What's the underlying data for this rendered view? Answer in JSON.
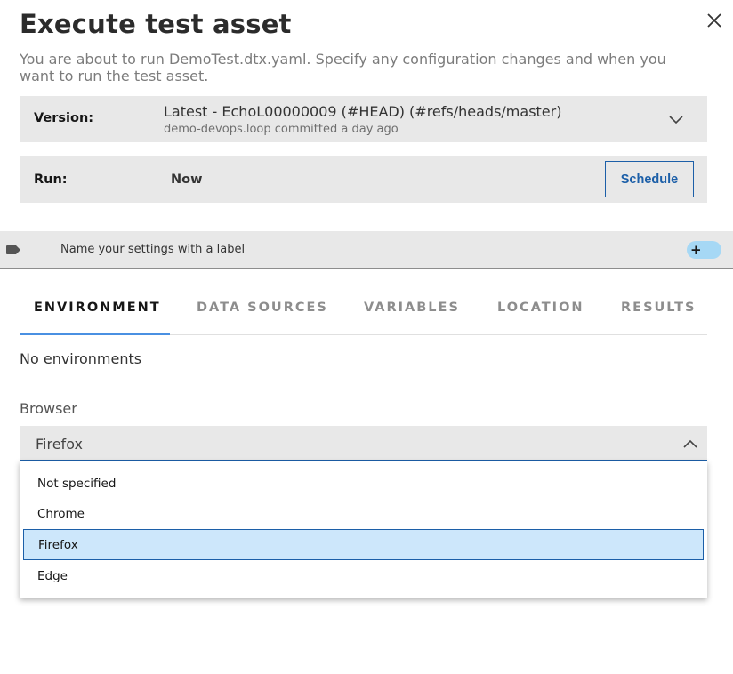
{
  "dialog": {
    "title": "Execute test asset",
    "description": "You are about to run DemoTest.dtx.yaml. Specify any configuration changes and when you want to run the test asset."
  },
  "version": {
    "label": "Version:",
    "value": "Latest - EchoL00000009 (#HEAD) (#refs/heads/master)",
    "commit_info": "demo-devops.loop committed a day ago"
  },
  "run": {
    "label": "Run:",
    "value": "Now",
    "schedule_label": "Schedule"
  },
  "label_bar": {
    "text": "Name your settings with a label",
    "toggle_symbol": "+"
  },
  "tabs": [
    {
      "label": "ENVIRONMENT",
      "active": true
    },
    {
      "label": "DATA SOURCES",
      "active": false
    },
    {
      "label": "VARIABLES",
      "active": false
    },
    {
      "label": "LOCATION",
      "active": false
    },
    {
      "label": "RESULTS",
      "active": false
    }
  ],
  "environment": {
    "empty_text": "No environments",
    "browser_label": "Browser",
    "browser_selected": "Firefox",
    "browser_options": [
      "Not specified",
      "Chrome",
      "Firefox",
      "Edge"
    ]
  },
  "colors": {
    "accent": "#1c5fa8",
    "tab_underline": "#4a90e2",
    "selected_bg": "#cde7fb",
    "toggle_bg": "#a6d8f5",
    "panel_bg": "#e8e8e8"
  },
  "icons": [
    "close-icon",
    "chevron-down-icon",
    "tag-icon",
    "chevron-up-icon"
  ]
}
